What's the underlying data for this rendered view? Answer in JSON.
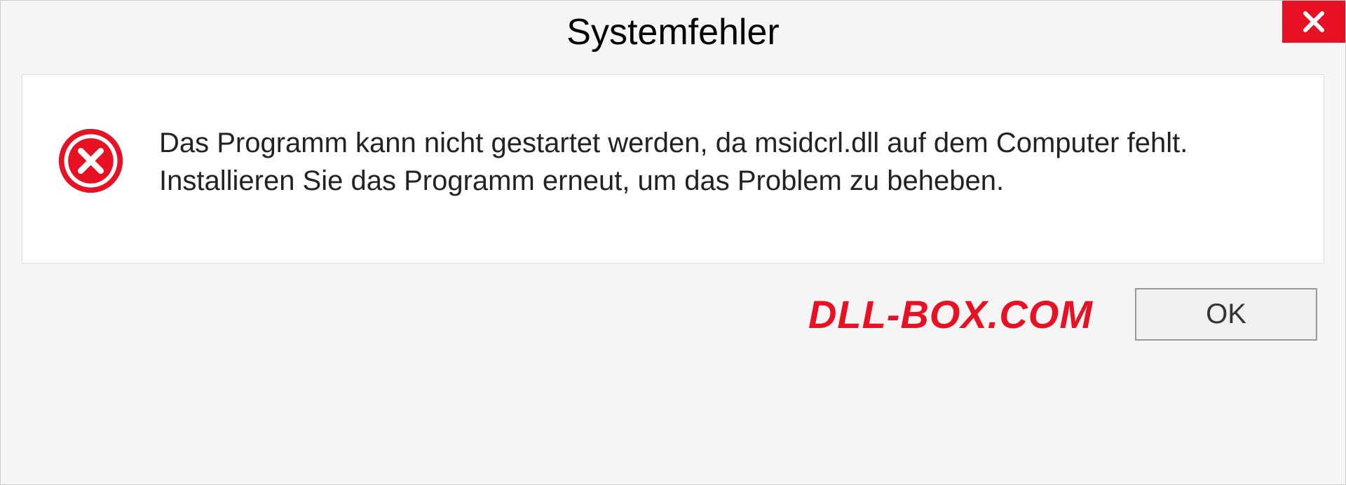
{
  "dialog": {
    "title": "Systemfehler",
    "message": "Das Programm kann nicht gestartet werden, da msidcrl.dll auf dem Computer fehlt. Installieren Sie das Programm erneut, um das Problem zu beheben.",
    "watermark": "DLL-BOX.COM",
    "ok_label": "OK"
  }
}
